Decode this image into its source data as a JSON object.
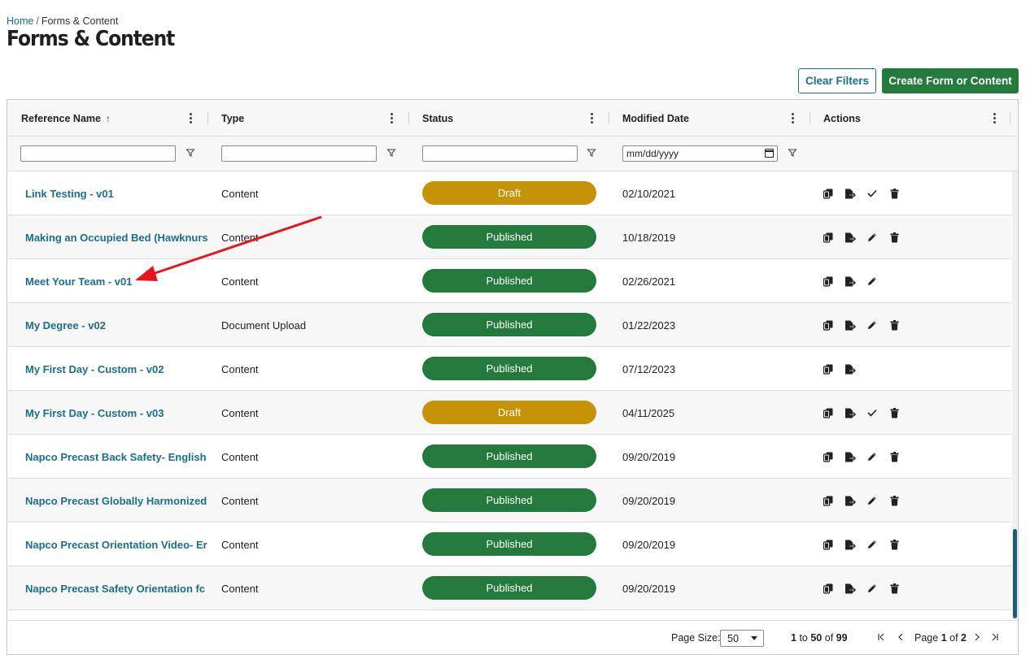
{
  "breadcrumb": {
    "home": "Home",
    "separator": "/",
    "current": "Forms & Content"
  },
  "page_title": "Forms & Content",
  "toolbar": {
    "clear_filters": "Clear Filters",
    "create": "Create Form or Content"
  },
  "columns": {
    "reference_name": "Reference Name",
    "type": "Type",
    "status": "Status",
    "modified_date": "Modified Date",
    "actions": "Actions"
  },
  "filters": {
    "date_placeholder": "mm/dd/yyyy"
  },
  "colors": {
    "published": "#237a3c",
    "draft": "#c59305",
    "link": "#1a6f8a",
    "accent": "#237a3c"
  },
  "rows": [
    {
      "name": "Link Testing - v01",
      "type": "Content",
      "status": "Draft",
      "date": "02/10/2021",
      "actions": [
        "copy-icon",
        "export-icon",
        "check-icon",
        "trash-icon"
      ]
    },
    {
      "name": "Making an Occupied Bed (Hawknurs",
      "type": "Content",
      "status": "Published",
      "date": "10/18/2019",
      "actions": [
        "copy-icon",
        "export-icon",
        "pencil-icon",
        "trash-icon"
      ]
    },
    {
      "name": "Meet Your Team - v01",
      "type": "Content",
      "status": "Published",
      "date": "02/26/2021",
      "actions": [
        "copy-icon",
        "export-icon",
        "pencil-icon"
      ]
    },
    {
      "name": "My Degree - v02",
      "type": "Document Upload",
      "status": "Published",
      "date": "01/22/2023",
      "actions": [
        "copy-icon",
        "export-icon",
        "pencil-icon",
        "trash-icon"
      ]
    },
    {
      "name": "My First Day - Custom - v02",
      "type": "Content",
      "status": "Published",
      "date": "07/12/2023",
      "actions": [
        "copy-icon",
        "export-icon"
      ]
    },
    {
      "name": "My First Day - Custom - v03",
      "type": "Content",
      "status": "Draft",
      "date": "04/11/2025",
      "actions": [
        "copy-icon",
        "export-icon",
        "check-icon",
        "trash-icon"
      ]
    },
    {
      "name": "Napco Precast Back Safety- English -",
      "type": "Content",
      "status": "Published",
      "date": "09/20/2019",
      "actions": [
        "copy-icon",
        "export-icon",
        "pencil-icon",
        "trash-icon"
      ]
    },
    {
      "name": "Napco Precast Globally Harmonized",
      "type": "Content",
      "status": "Published",
      "date": "09/20/2019",
      "actions": [
        "copy-icon",
        "export-icon",
        "pencil-icon",
        "trash-icon"
      ]
    },
    {
      "name": "Napco Precast Orientation Video- Er",
      "type": "Content",
      "status": "Published",
      "date": "09/20/2019",
      "actions": [
        "copy-icon",
        "export-icon",
        "pencil-icon",
        "trash-icon"
      ]
    },
    {
      "name": "Napco Precast Safety Orientation fc",
      "type": "Content",
      "status": "Published",
      "date": "09/20/2019",
      "actions": [
        "copy-icon",
        "export-icon",
        "pencil-icon",
        "trash-icon"
      ]
    }
  ],
  "pager": {
    "page_size_label": "Page Size:",
    "page_size": "50",
    "range_start": "1",
    "range_to": "to",
    "range_end": "50",
    "range_of": "of",
    "total": "99",
    "page_label": "Page",
    "page_current": "1",
    "page_of": "of",
    "page_total": "2"
  }
}
